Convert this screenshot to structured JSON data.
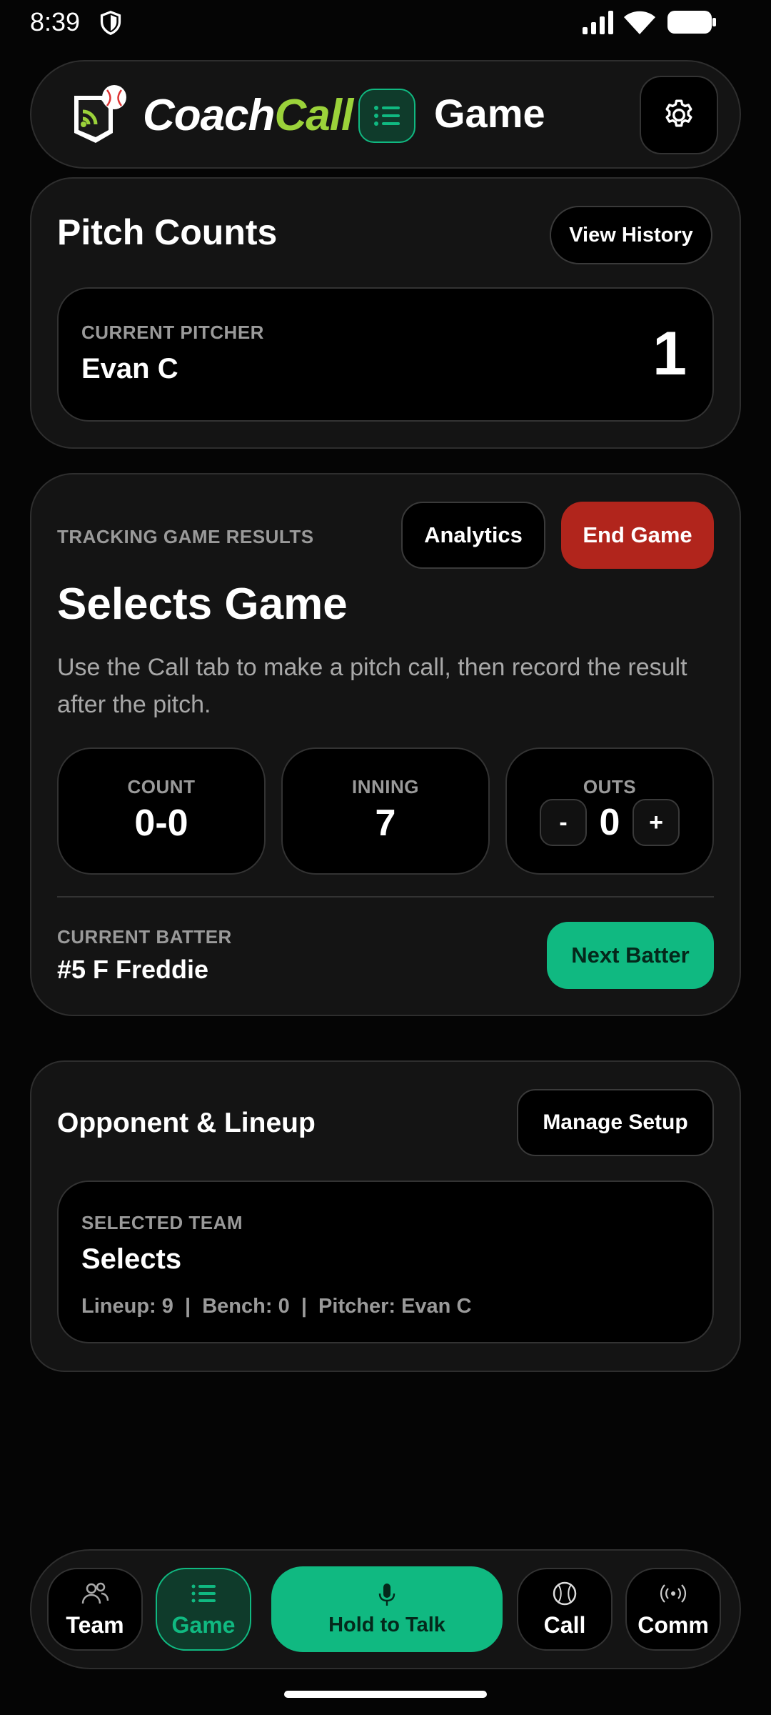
{
  "status_bar": {
    "time": "8:39"
  },
  "header": {
    "logo_coach": "Coach",
    "logo_call": "Call",
    "title": "Game"
  },
  "pitch_counts": {
    "title": "Pitch Counts",
    "view_history_label": "View History",
    "current_pitcher_label": "CURRENT PITCHER",
    "current_pitcher_name": "Evan C",
    "count": "1"
  },
  "game": {
    "tracking_label": "TRACKING GAME RESULTS",
    "analytics_label": "Analytics",
    "end_game_label": "End Game",
    "title": "Selects Game",
    "description": "Use the Call tab to make a pitch call, then record the result after the pitch.",
    "stats": {
      "count_label": "COUNT",
      "count_value": "0-0",
      "inning_label": "INNING",
      "inning_value": "7",
      "outs_label": "OUTS",
      "outs_value": "0",
      "outs_minus": "-",
      "outs_plus": "+"
    },
    "current_batter_label": "CURRENT BATTER",
    "current_batter_name": "#5 F Freddie",
    "next_batter_label": "Next Batter"
  },
  "opponent": {
    "title": "Opponent & Lineup",
    "manage_label": "Manage Setup",
    "selected_team_label": "SELECTED TEAM",
    "team_name": "Selects",
    "meta": "Lineup: 9  |  Bench: 0  |  Pitcher: Evan C"
  },
  "bottom_nav": {
    "team_label": "Team",
    "game_label": "Game",
    "talk_label": "Hold to Talk",
    "call_label": "Call",
    "comm_label": "Comm"
  },
  "colors": {
    "accent": "#10b981",
    "danger": "#b1251c",
    "logo_green": "#9bd23a"
  }
}
